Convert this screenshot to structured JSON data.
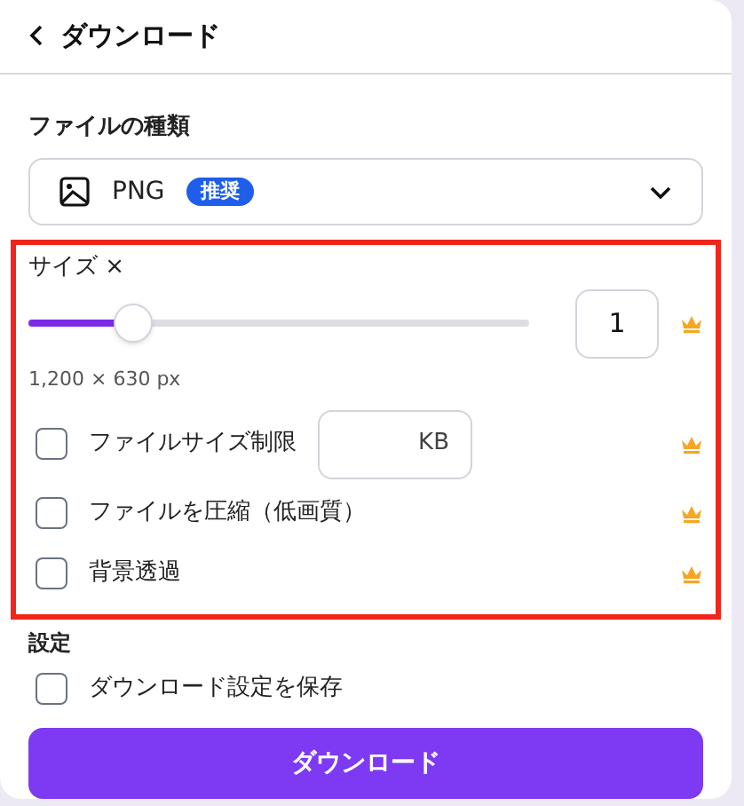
{
  "header": {
    "title": "ダウンロード"
  },
  "file_type": {
    "label": "ファイルの種類",
    "value": "PNG",
    "badge": "推奨"
  },
  "size": {
    "label": "サイズ ×",
    "level": 0.21,
    "value": "1",
    "premium": true,
    "dimensions": "1,200 × 630 px"
  },
  "options": [
    {
      "kind": "limit",
      "label": "ファイルサイズ制限",
      "checked": false,
      "unit": "KB",
      "premium": true
    },
    {
      "kind": "checkbox",
      "label": "ファイルを圧縮（低画質）",
      "checked": false,
      "premium": true
    },
    {
      "kind": "checkbox",
      "label": "背景透過",
      "checked": false,
      "premium": true
    }
  ],
  "settings": {
    "label": "設定",
    "options": [
      {
        "label": "ダウンロード設定を保存",
        "checked": false
      }
    ]
  },
  "download_button": {
    "label": "ダウンロード"
  }
}
